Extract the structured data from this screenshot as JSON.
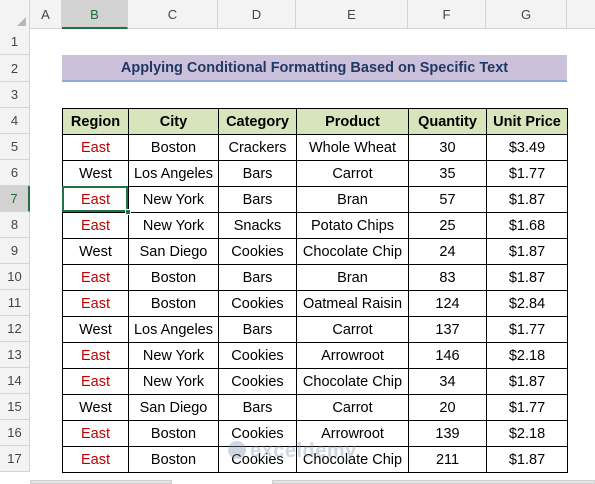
{
  "columns": [
    "A",
    "B",
    "C",
    "D",
    "E",
    "F",
    "G"
  ],
  "selected_column": "B",
  "rows": [
    "1",
    "2",
    "3",
    "4",
    "5",
    "6",
    "7",
    "8",
    "9",
    "10",
    "11",
    "12",
    "13",
    "14",
    "15",
    "16",
    "17"
  ],
  "selected_row": "7",
  "title": "Applying Conditional Formatting Based on Specific Text",
  "table": {
    "headers": [
      "Region",
      "City",
      "Category",
      "Product",
      "Quantity",
      "Unit Price"
    ],
    "rows": [
      [
        "East",
        "Boston",
        "Crackers",
        "Whole Wheat",
        "30",
        "$3.49"
      ],
      [
        "West",
        "Los Angeles",
        "Bars",
        "Carrot",
        "35",
        "$1.77"
      ],
      [
        "East",
        "New York",
        "Bars",
        "Bran",
        "57",
        "$1.87"
      ],
      [
        "East",
        "New York",
        "Snacks",
        "Potato Chips",
        "25",
        "$1.68"
      ],
      [
        "West",
        "San Diego",
        "Cookies",
        "Chocolate Chip",
        "24",
        "$1.87"
      ],
      [
        "East",
        "Boston",
        "Bars",
        "Bran",
        "83",
        "$1.87"
      ],
      [
        "East",
        "Boston",
        "Cookies",
        "Oatmeal Raisin",
        "124",
        "$2.84"
      ],
      [
        "West",
        "Los Angeles",
        "Bars",
        "Carrot",
        "137",
        "$1.77"
      ],
      [
        "East",
        "New York",
        "Cookies",
        "Arrowroot",
        "146",
        "$2.18"
      ],
      [
        "East",
        "New York",
        "Cookies",
        "Chocolate Chip",
        "34",
        "$1.87"
      ],
      [
        "West",
        "San Diego",
        "Bars",
        "Carrot",
        "20",
        "$1.77"
      ],
      [
        "East",
        "Boston",
        "Cookies",
        "Arrowroot",
        "139",
        "$2.18"
      ],
      [
        "East",
        "Boston",
        "Cookies",
        "Chocolate Chip",
        "211",
        "$1.87"
      ]
    ]
  },
  "highlight_text": "East",
  "colors": {
    "highlight_font": "#c00000",
    "header_fill": "#d8e4bc",
    "title_fill": "#ccc1da",
    "title_font": "#203864",
    "selection": "#217346"
  },
  "watermark": "exceldemy"
}
